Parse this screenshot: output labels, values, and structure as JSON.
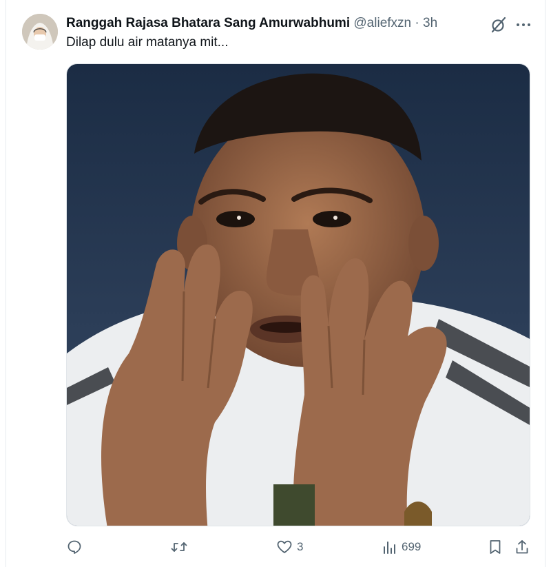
{
  "tweet": {
    "author_name": "Ranggah Rajasa Bhatara Sang Amurwabhumi",
    "handle": "@aliefxzn",
    "separator": "·",
    "time": "3h",
    "text": "Dilap dulu air matanya mit..."
  },
  "icons": {
    "grok": "grok-icon",
    "more": "more-icon",
    "reply": "reply-icon",
    "retweet": "retweet-icon",
    "like": "heart-icon",
    "views": "views-icon",
    "bookmark": "bookmark-icon",
    "share": "share-icon"
  },
  "actions": {
    "reply_count": "",
    "retweet_count": "",
    "like_count": "3",
    "view_count": "699"
  },
  "colors": {
    "text_primary": "#0f1419",
    "text_secondary": "#536471"
  }
}
